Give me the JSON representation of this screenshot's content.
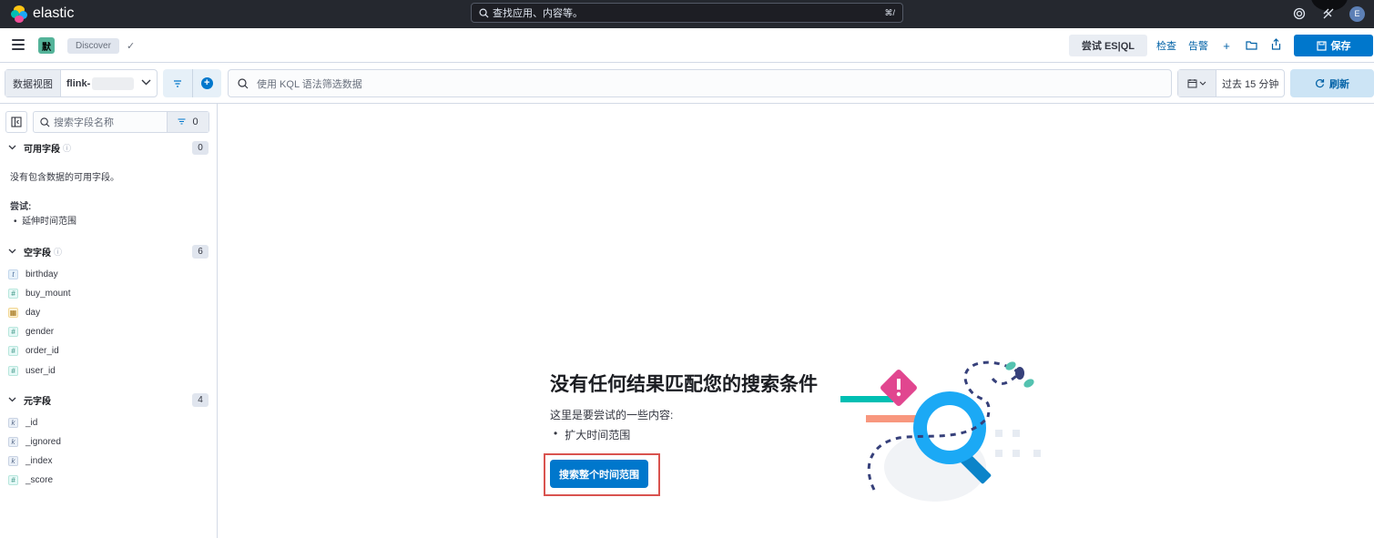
{
  "app": {
    "logo_text": "elastic"
  },
  "global_search": {
    "placeholder": "查找应用、内容等。",
    "shortcut": "⌘/"
  },
  "user": {
    "initial": "E"
  },
  "nav": {
    "space_badge": "默",
    "breadcrumb": "Discover",
    "try_esql": "尝试 ES|QL",
    "inspect": "检查",
    "alerts": "告警",
    "save": "保存"
  },
  "query": {
    "data_view_label": "数据视图",
    "data_view_value": "flink-",
    "kql_placeholder": "使用 KQL 语法筛选数据",
    "time_range": "过去 15 分钟",
    "refresh": "刷新"
  },
  "sidebar": {
    "search_placeholder": "搜索字段名称",
    "filter_count": "0",
    "available": {
      "title": "可用字段",
      "count": "0",
      "empty_text": "没有包含数据的可用字段。",
      "try_label": "尝试:",
      "suggestion": "延伸时间范围"
    },
    "empty_fields": {
      "title": "空字段",
      "count": "6",
      "fields": [
        {
          "name": "birthday",
          "type": "t"
        },
        {
          "name": "buy_mount",
          "type": "#"
        },
        {
          "name": "day",
          "type": "date"
        },
        {
          "name": "gender",
          "type": "#"
        },
        {
          "name": "order_id",
          "type": "#"
        },
        {
          "name": "user_id",
          "type": "#"
        }
      ]
    },
    "meta_fields": {
      "title": "元字段",
      "count": "4",
      "fields": [
        {
          "name": "_id",
          "type": "k"
        },
        {
          "name": "_ignored",
          "type": "k"
        },
        {
          "name": "_index",
          "type": "k"
        },
        {
          "name": "_score",
          "type": "#"
        }
      ]
    }
  },
  "empty_state": {
    "title": "没有任何结果匹配您的搜索条件",
    "subtitle": "这里是要尝试的一些内容:",
    "suggestion": "扩大时间范围",
    "button": "搜索整个时间范围"
  },
  "colors": {
    "primary": "#0077cc",
    "header_dark": "#25282f",
    "highlight": "#d9534f",
    "space_badge": "#54b399"
  }
}
